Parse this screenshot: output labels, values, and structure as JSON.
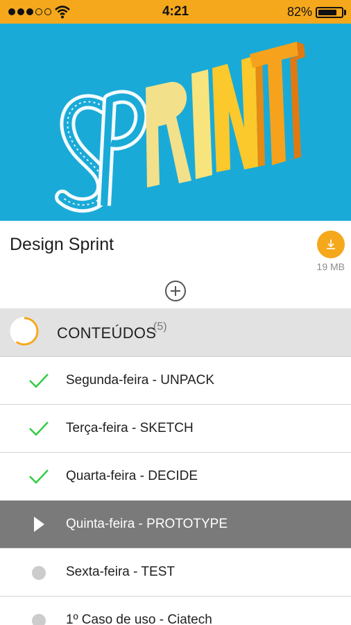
{
  "status_bar": {
    "time": "4:21",
    "battery_percent": "82%",
    "battery_level": 0.82,
    "signal_bars_filled": 3,
    "signal_bars_total": 5
  },
  "hero": {
    "image_text": "SPRINT",
    "background_color": "#1aaad8"
  },
  "course": {
    "title": "Design Sprint",
    "file_size": "19 MB",
    "download_icon": "download-icon",
    "add_icon": "plus-circle-icon"
  },
  "section": {
    "title": "CONTEÚDOS",
    "count": "(5)",
    "progress_fraction": 0.6
  },
  "items": [
    {
      "label": "Segunda-feira - UNPACK",
      "status": "done",
      "icon": "check-icon"
    },
    {
      "label": "Terça-feira - SKETCH",
      "status": "done",
      "icon": "check-icon"
    },
    {
      "label": "Quarta-feira - DECIDE",
      "status": "done",
      "icon": "check-icon"
    },
    {
      "label": "Quinta-feira - PROTOTYPE",
      "status": "playing",
      "icon": "play-icon"
    },
    {
      "label": "Sexta-feira - TEST",
      "status": "pending",
      "icon": "dot-icon"
    },
    {
      "label": "1º Caso de uso - Ciatech",
      "status": "pending",
      "icon": "dot-icon"
    }
  ],
  "colors": {
    "accent": "#f5a81c",
    "check": "#2ecc40",
    "active_row": "#7a7a7a",
    "section_bg": "#e2e2e2"
  }
}
